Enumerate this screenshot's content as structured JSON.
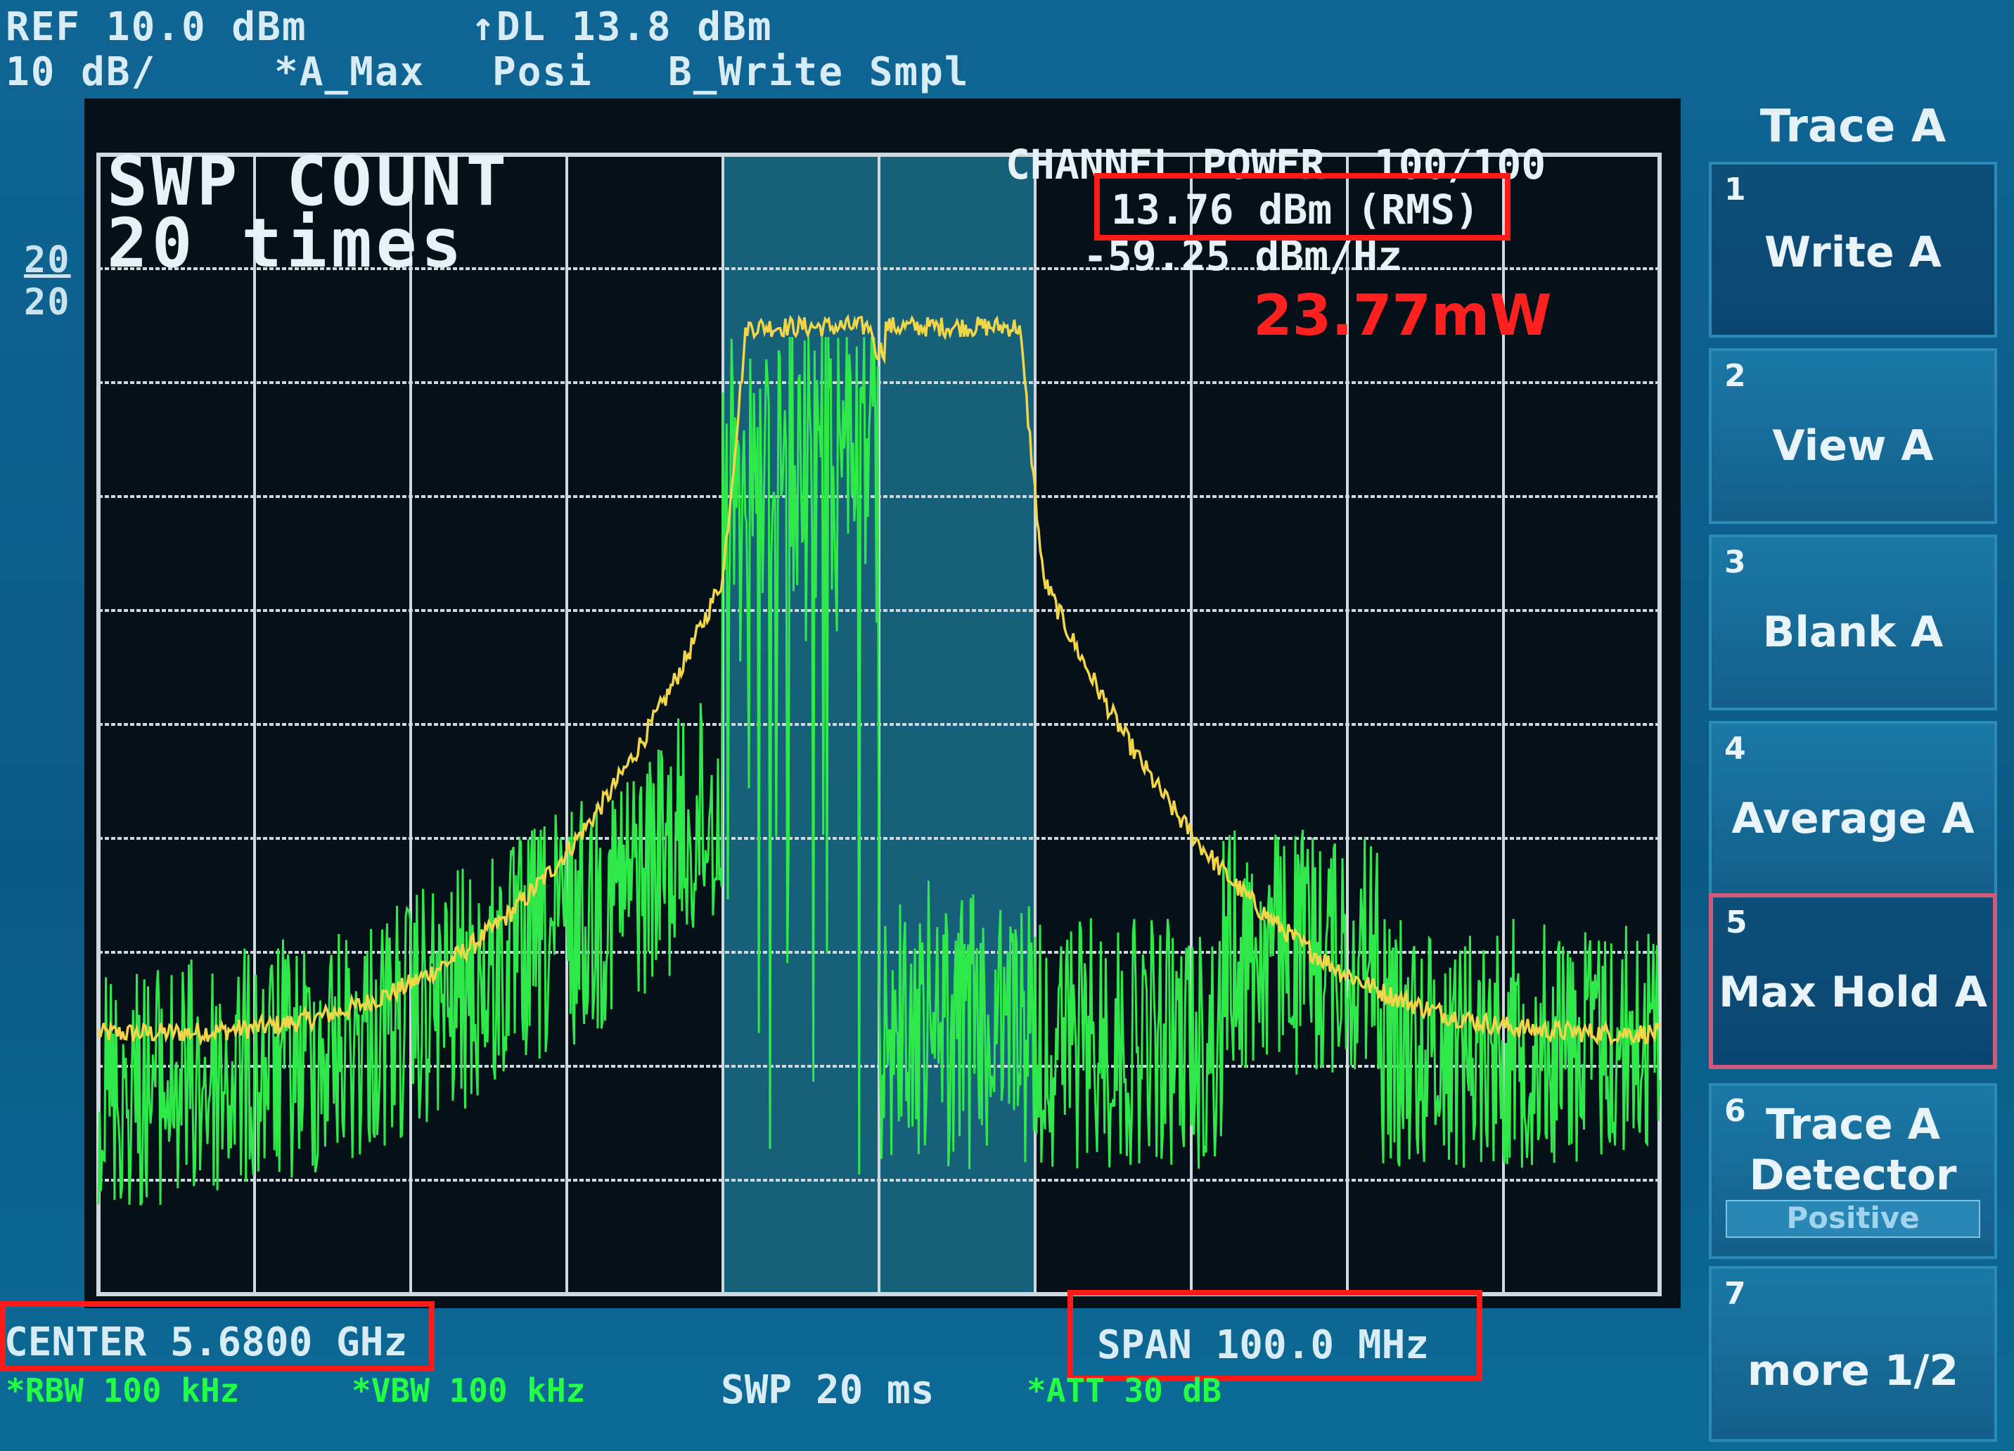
{
  "header": {
    "ref_level": "REF 10.0 dBm",
    "scale": "10 dB/",
    "display_line": "↑DL 13.8 dBm",
    "trace_a_mode": "*A_Max",
    "detector": "Posi",
    "trace_b_mode": "B_Write Smpl"
  },
  "side_scale": {
    "top": "20",
    "bottom": "20"
  },
  "overlay": {
    "swp_count_line1": "SWP COUNT",
    "swp_count_line2": "20 times",
    "channel_power_label": "CHANNEL POWER  100/100",
    "channel_power_rms": "13.76 dBm (RMS)",
    "channel_power_density": "-59.25 dBm/Hz",
    "annotation_mw": "23.77mW"
  },
  "footer": {
    "center": "CENTER 5.6800 GHz",
    "span": "SPAN 100.0 MHz",
    "rbw": "*RBW 100 kHz",
    "vbw": "*VBW 100 kHz",
    "sweep": "SWP 20 ms",
    "attenuation": "*ATT 30 dB"
  },
  "softkeys": {
    "title": "Trace A",
    "items": [
      {
        "num": "1",
        "label": "Write A"
      },
      {
        "num": "2",
        "label": "View A"
      },
      {
        "num": "3",
        "label": "Blank A"
      },
      {
        "num": "4",
        "label": "Average A"
      },
      {
        "num": "5",
        "label": "Max Hold A"
      },
      {
        "num": "6",
        "label_line1": "Trace A",
        "label_line2": "Detector",
        "sub": "Positive"
      },
      {
        "num": "7",
        "label": "more 1/2"
      }
    ]
  },
  "colors": {
    "trace_a": "#f2d64a",
    "trace_b": "#2fe84a",
    "grid": "#cfd8dc",
    "channel_band": "#1a6f8c",
    "highlight": "#ff1a1a"
  }
}
